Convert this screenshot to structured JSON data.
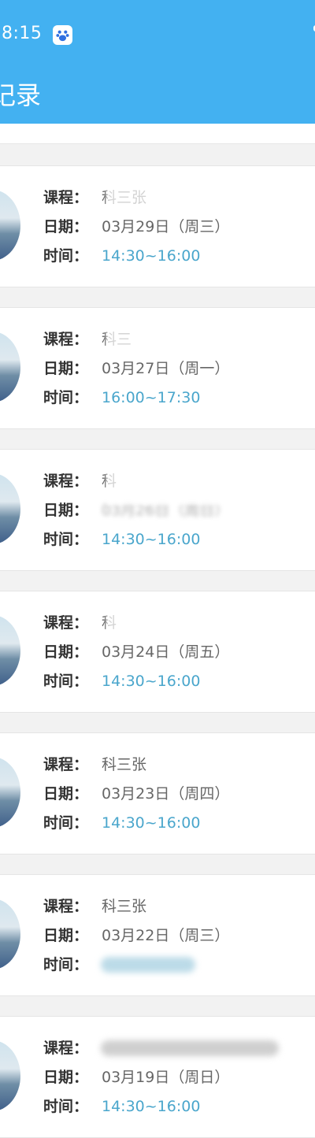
{
  "status_bar": {
    "time": "8:15",
    "app_icon": "baidu-paw-icon"
  },
  "header": {
    "title": "记录",
    "background": "#43b1f1"
  },
  "labels": {
    "course": "课程：",
    "date": "日期：",
    "time": "时间："
  },
  "records": [
    {
      "course": "科三张",
      "date": "03月29日（周三）",
      "time": "14:30~16:00"
    },
    {
      "course": "科三",
      "date": "03月27日（周一）",
      "time": "16:00~17:30"
    },
    {
      "course": "科",
      "date": "03月26日（周日）",
      "time": "14:30~16:00"
    },
    {
      "course": "科",
      "date": "03月24日（周五）",
      "time": "14:30~16:00"
    },
    {
      "course": "科三张",
      "date": "03月23日（周四）",
      "time": "14:30~16:00"
    },
    {
      "course": "科三张",
      "date": "03月22日（周三）",
      "time": ""
    },
    {
      "course": "",
      "date": "03月19日（周日）",
      "time": "14:30~16:00"
    }
  ],
  "colors": {
    "label": "#333333",
    "value": "#666666",
    "time_accent": "#4aa6cc",
    "background": "#f2f2f2"
  }
}
